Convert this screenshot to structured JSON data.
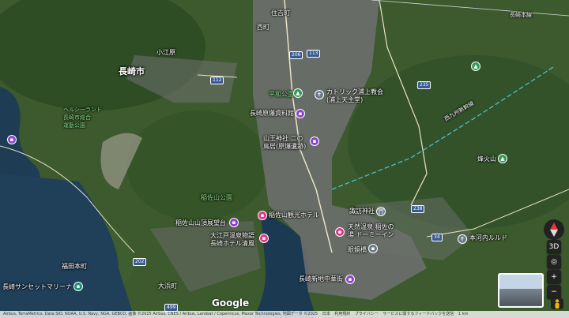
{
  "city_label": "長崎市",
  "area_labels": [
    {
      "id": "nishimachi",
      "text": "西町"
    },
    {
      "id": "sumiyoshi",
      "text": "住吉町"
    },
    {
      "id": "koebara",
      "text": "小江原"
    },
    {
      "id": "inasayama-park",
      "text": "稲佐山公園"
    },
    {
      "id": "nagasaki-city-park",
      "text": "ヘルシーランド\n長崎市総合\n運動公園"
    },
    {
      "id": "fukuda",
      "text": "福田本町"
    },
    {
      "id": "ohama",
      "text": "大浜町"
    },
    {
      "id": "heiwa-park",
      "text": "平和公園"
    }
  ],
  "route_shields": [
    "206",
    "113",
    "112",
    "235",
    "238",
    "202",
    "34",
    "499"
  ],
  "pois": [
    {
      "id": "urakami-cathedral",
      "text": "カトリック浦上教会\n(浦上天主堂)",
      "kind": "gray"
    },
    {
      "id": "atomic-museum",
      "text": "長崎原爆資料館",
      "kind": "purple"
    },
    {
      "id": "sanno-shrine",
      "text": "山王神社 二の\n鳥居(原爆遺跡)",
      "kind": "purple"
    },
    {
      "id": "inasayama-observatory",
      "text": "稲佐山山頂展望台",
      "kind": "purple"
    },
    {
      "id": "inasayama-hotel",
      "text": "稲佐山観光ホテル",
      "kind": "pink"
    },
    {
      "id": "oedo-onsen",
      "text": "大江戸温泉物語\n長崎ホテル清風",
      "kind": "pink"
    },
    {
      "id": "suwa-shrine",
      "text": "諏訪神社",
      "kind": "gray"
    },
    {
      "id": "megane-bashi",
      "text": "眼鏡橋",
      "kind": "gray"
    },
    {
      "id": "tenmangu",
      "text": "天然温泉 稲佐の\n湯 ドーミーイン",
      "kind": "pink"
    },
    {
      "id": "shinchi-chinatown",
      "text": "長崎新地中華街",
      "kind": "purple"
    },
    {
      "id": "hokawachi",
      "text": "本河内ルルド",
      "kind": "gray"
    },
    {
      "id": "hokazan",
      "text": "烽火山",
      "kind": "green"
    },
    {
      "id": "sunset-marina",
      "text": "長崎サンセットマリーナ",
      "kind": "teal"
    }
  ],
  "rail_label": "西九州新幹線",
  "road_label": "長崎本線",
  "google_logo": "Google",
  "footer_items": [
    "Airbus, TerraMetrics, Data SIO, NOAA, U.S. Navy, NGA, GEBCO, 画像 ©2025 Airbus, CNES / Airbus, Landsat / Copernicus, Maxar Technologies, 地図データ ©2025",
    "日本",
    "利用規約",
    "プライバシー",
    "サービスに関するフィードバックを送信",
    "1 km"
  ],
  "controls": {
    "compass": "N",
    "view_3d": "3D",
    "zoom_in": "+",
    "zoom_out": "−"
  }
}
